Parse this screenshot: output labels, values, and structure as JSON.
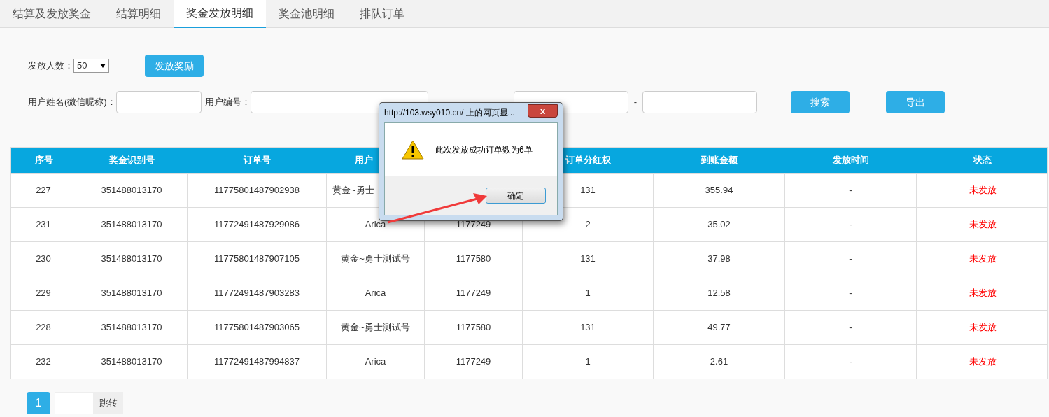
{
  "tabs": [
    {
      "label": "结算及发放奖金",
      "selected": false
    },
    {
      "label": "结算明细",
      "selected": false
    },
    {
      "label": "奖金发放明细",
      "selected": true
    },
    {
      "label": "奖金池明细",
      "selected": false
    },
    {
      "label": "排队订单",
      "selected": false
    }
  ],
  "filters": {
    "count_label": "发放人数：",
    "count_value": "50",
    "issue_button": "发放奖励",
    "name_label": "用户姓名(微信昵称)：",
    "number_label": "用户编号：",
    "time_separator": "-",
    "search_button": "搜索",
    "export_button": "导出"
  },
  "table": {
    "columns": [
      {
        "label": "序号"
      },
      {
        "label": "奖金识别号"
      },
      {
        "label": "订单号"
      },
      {
        "label": "用户"
      },
      {},
      {
        "label": "订单分红权"
      },
      {
        "label": "到账金额"
      },
      {
        "label": "发放时间"
      },
      {
        "label": "状态"
      }
    ],
    "rows": [
      [
        "227",
        "351488013170",
        "11775801487902938",
        "黄金~勇士",
        null,
        "131",
        "355.94",
        "-",
        "未发放"
      ],
      [
        "231",
        "351488013170",
        "11772491487929086",
        "Arica",
        "1177249",
        "2",
        "35.02",
        "-",
        "未发放"
      ],
      [
        "230",
        "351488013170",
        "11775801487907105",
        "黄金~勇士测试号",
        "1177580",
        "131",
        "37.98",
        "-",
        "未发放"
      ],
      [
        "229",
        "351488013170",
        "11772491487903283",
        "Arica",
        "1177249",
        "1",
        "12.58",
        "-",
        "未发放"
      ],
      [
        "228",
        "351488013170",
        "11775801487903065",
        "黄金~勇士测试号",
        "1177580",
        "131",
        "49.77",
        "-",
        "未发放"
      ],
      [
        "232",
        "351488013170",
        "11772491487994837",
        "Arica",
        "1177249",
        "1",
        "2.61",
        "-",
        "未发放"
      ]
    ]
  },
  "pagination": {
    "pages": [
      {
        "label": "1",
        "selected": true
      }
    ],
    "jump_button": "跳转"
  },
  "dialog": {
    "title": "http://103.wsy010.cn/ 上的网页显...",
    "close": "x",
    "message": "此次发放成功订单数为6单",
    "ok_button": "确定"
  }
}
